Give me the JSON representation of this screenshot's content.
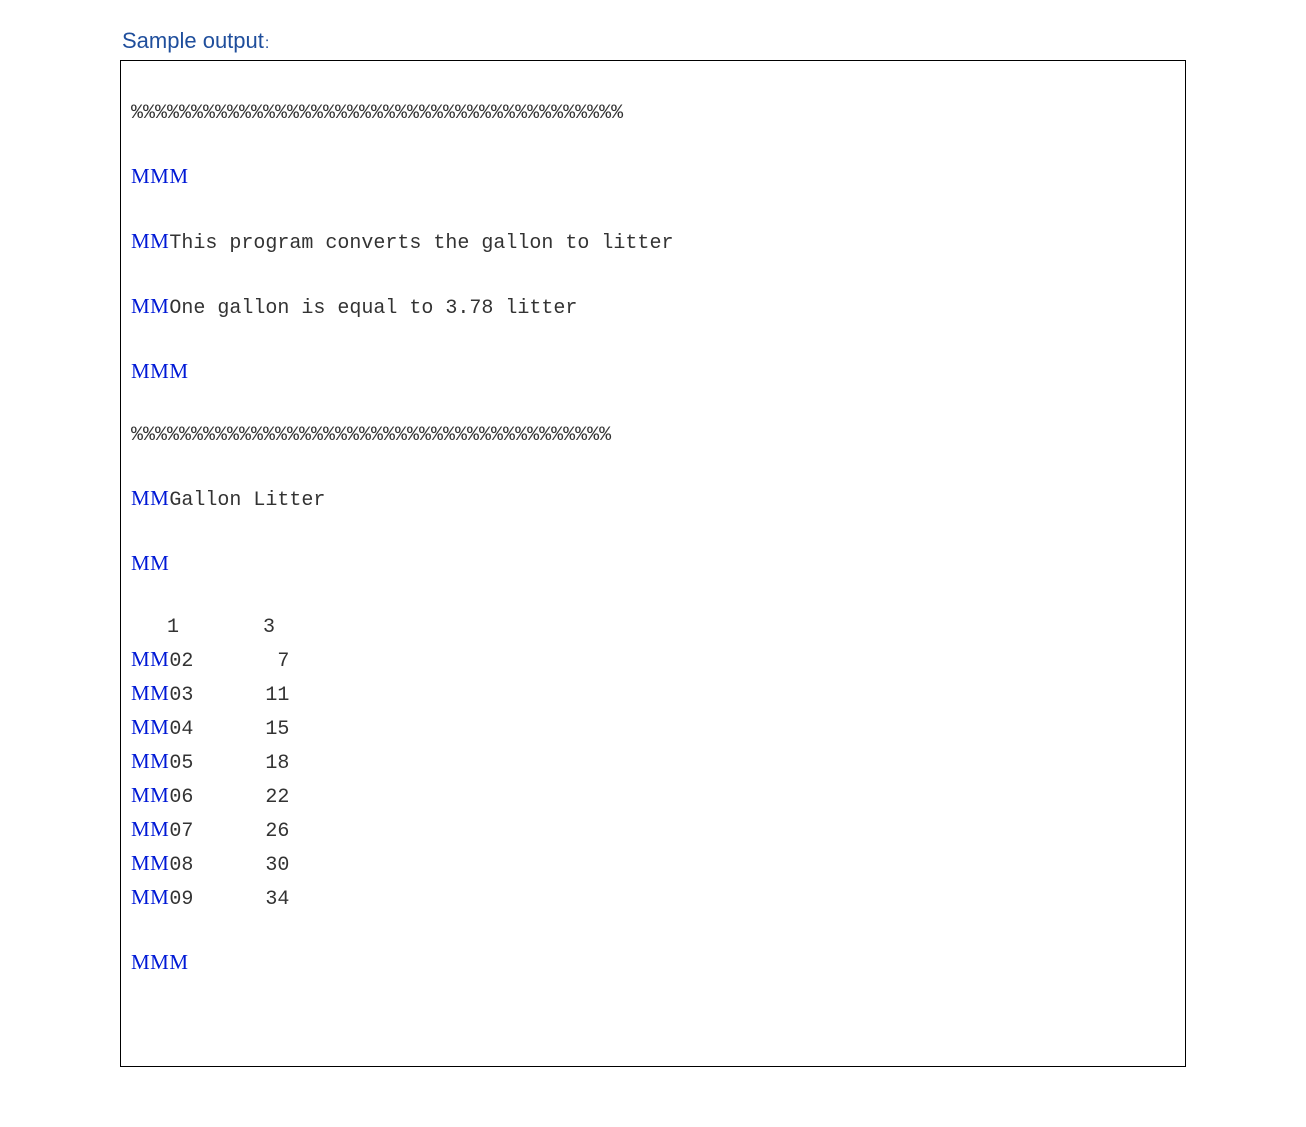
{
  "title": "Sample output",
  "colon": ":",
  "mm_token": "MM",
  "border_top": "%%%%%%%%%%%%%%%%%%%%%%%%%%%%%%%%%%%%%%%%%",
  "border_bottom": "%%%%%%%%%%%%%%%%%%%%%%%%%%%%%%%%%%%%%%%%",
  "mm3": "MMM",
  "mm2": "MM",
  "desc1": "This program converts the gallon to litter",
  "desc2": "One gallon is equal to 3.78 litter",
  "header": "Gallon Litter",
  "rows": [
    {
      "prefix": "  ",
      "gallon": " 1",
      "litter": "  3",
      "use_mm": false
    },
    {
      "prefix": "MM",
      "gallon": "02",
      "litter": "  7",
      "use_mm": true
    },
    {
      "prefix": "MM",
      "gallon": "03",
      "litter": " 11",
      "use_mm": true
    },
    {
      "prefix": "MM",
      "gallon": "04",
      "litter": " 15",
      "use_mm": true
    },
    {
      "prefix": "MM",
      "gallon": "05",
      "litter": " 18",
      "use_mm": true
    },
    {
      "prefix": "MM",
      "gallon": "06",
      "litter": " 22",
      "use_mm": true
    },
    {
      "prefix": "MM",
      "gallon": "07",
      "litter": " 26",
      "use_mm": true
    },
    {
      "prefix": "MM",
      "gallon": "08",
      "litter": " 30",
      "use_mm": true
    },
    {
      "prefix": "MM",
      "gallon": "09",
      "litter": " 34",
      "use_mm": true
    }
  ],
  "chart_data": {
    "type": "table",
    "title": "Gallon Litter",
    "columns": [
      "Gallon",
      "Litter"
    ],
    "rows": [
      [
        1,
        3
      ],
      [
        2,
        7
      ],
      [
        3,
        11
      ],
      [
        4,
        15
      ],
      [
        5,
        18
      ],
      [
        6,
        22
      ],
      [
        7,
        26
      ],
      [
        8,
        30
      ],
      [
        9,
        34
      ]
    ],
    "note": "One gallon is equal to 3.78 litter"
  }
}
